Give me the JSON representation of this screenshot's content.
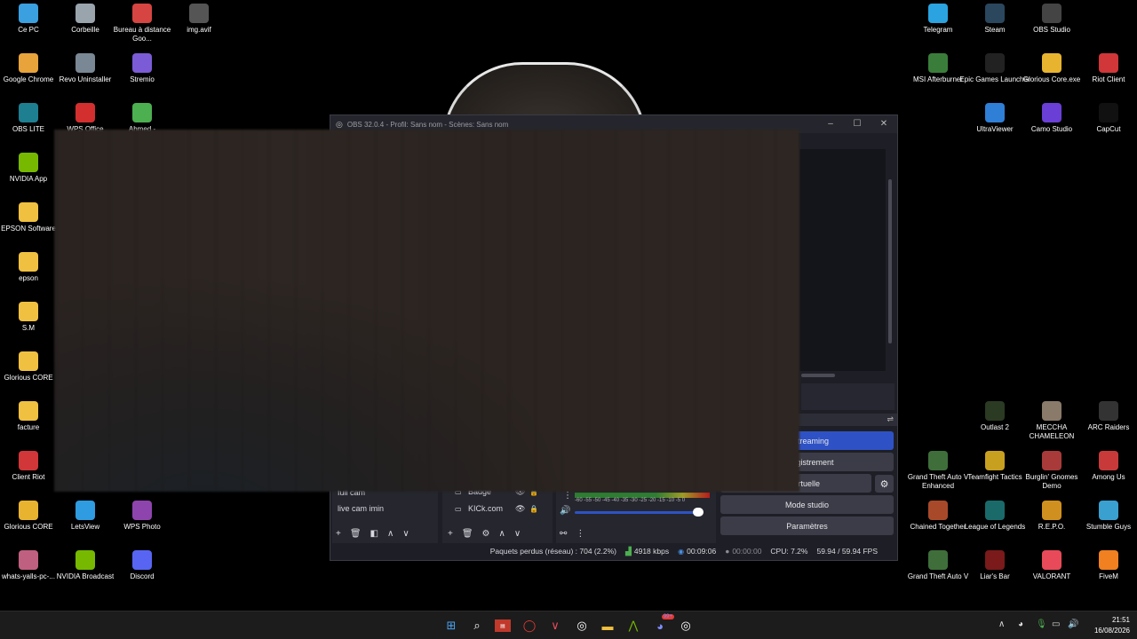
{
  "desktop_icons_left": [
    {
      "label": "Ce PC",
      "icon": "computer-icon",
      "color": "#3aa0e0"
    },
    {
      "label": "Corbeille",
      "icon": "recycle-bin-icon",
      "color": "#9aa4ad"
    },
    {
      "label": "Bureau à distance Goo...",
      "icon": "remote-desktop-icon",
      "color": "#d64541"
    },
    {
      "label": "img.avif",
      "icon": "image-file-icon",
      "color": "#555555"
    },
    {
      "label": "Google Chrome",
      "icon": "chrome-icon",
      "color": "#e8a33a"
    },
    {
      "label": "Revo Uninstaller",
      "icon": "revo-uninstaller-icon",
      "color": "#7a8794"
    },
    {
      "label": "Stremio",
      "icon": "stremio-icon",
      "color": "#7b5cd6"
    },
    {
      "label": "OBS LITE",
      "icon": "obs-lite-icon",
      "color": "#1e7f91"
    },
    {
      "label": "WPS Office",
      "icon": "wps-office-icon",
      "color": "#d32f2f"
    },
    {
      "label": "Ahmed -",
      "icon": "chrome-profile-icon",
      "color": "#4caf50"
    },
    {
      "label": "NVIDIA App",
      "icon": "nvidia-icon",
      "color": "#76b900"
    },
    {
      "label": "EPSON Software",
      "icon": "folder-icon",
      "color": "#f0c040"
    },
    {
      "label": "epson",
      "icon": "folder-icon",
      "color": "#f0c040"
    },
    {
      "label": "S.M",
      "icon": "folder-icon",
      "color": "#f0c040"
    },
    {
      "label": "Glorious CORE",
      "icon": "folder-icon",
      "color": "#f0c040"
    },
    {
      "label": "facture",
      "icon": "folder-icon",
      "color": "#f0c040"
    },
    {
      "label": "Client Riot",
      "icon": "riot-client-icon",
      "color": "#d13639"
    },
    {
      "label": "Glorious CORE",
      "icon": "glorious-core-icon",
      "color": "#e8b430"
    },
    {
      "label": "LetsView",
      "icon": "letsview-icon",
      "color": "#2f9be0"
    },
    {
      "label": "WPS Photo",
      "icon": "wps-photo-icon",
      "color": "#8e44ad"
    },
    {
      "label": "whats-yalls-pc-...",
      "icon": "image-file-icon",
      "color": "#c06080"
    },
    {
      "label": "NVIDIA Broadcast",
      "icon": "nvidia-broadcast-icon",
      "color": "#76b900"
    },
    {
      "label": "Discord",
      "icon": "discord-icon",
      "color": "#5865f2"
    }
  ],
  "desktop_icons_right": [
    {
      "label": "Telegram",
      "icon": "telegram-icon",
      "color": "#2aa3e0"
    },
    {
      "label": "Steam",
      "icon": "steam-icon",
      "color": "#2a475e"
    },
    {
      "label": "OBS Studio",
      "icon": "obs-studio-icon",
      "color": "#444444"
    },
    {
      "label": "MSI Afterburner",
      "icon": "msi-afterburner-icon",
      "color": "#3a7d3a"
    },
    {
      "label": "Epic Games Launcher",
      "icon": "epic-games-icon",
      "color": "#222222"
    },
    {
      "label": "Glorious Core.exe",
      "icon": "glorious-core-icon",
      "color": "#e8b430"
    },
    {
      "label": "Riot Client",
      "icon": "riot-client-icon",
      "color": "#d13639"
    },
    {
      "label": "UltraViewer",
      "icon": "ultraviewer-icon",
      "color": "#2f7fd6"
    },
    {
      "label": "Camo Studio",
      "icon": "camo-studio-icon",
      "color": "#6a3fd6"
    },
    {
      "label": "CapCut",
      "icon": "capcut-icon",
      "color": "#111111"
    },
    {
      "label": "Outlast 2",
      "icon": "outlast-2-icon",
      "color": "#2b3a22"
    },
    {
      "label": "MECCHA CHAMELEON",
      "icon": "meccha-chameleon-icon",
      "color": "#8a7a6a"
    },
    {
      "label": "ARC Raiders",
      "icon": "arc-raiders-icon",
      "color": "#333333"
    },
    {
      "label": "Grand Theft Auto V Enhanced",
      "icon": "gta-v-enhanced-icon",
      "color": "#3f6e3a"
    },
    {
      "label": "Teamfight Tactics",
      "icon": "teamfight-tactics-icon",
      "color": "#c8a020"
    },
    {
      "label": "Burglin' Gnomes Demo",
      "icon": "burglin-gnomes-icon",
      "color": "#a83a3a"
    },
    {
      "label": "Among Us",
      "icon": "among-us-icon",
      "color": "#c83a3a"
    },
    {
      "label": "Chained Together",
      "icon": "chained-together-icon",
      "color": "#a84a2a"
    },
    {
      "label": "League of Legends",
      "icon": "league-of-legends-icon",
      "color": "#1a6a6a"
    },
    {
      "label": "R.E.P.O.",
      "icon": "repo-icon",
      "color": "#d09020"
    },
    {
      "label": "Stumble Guys",
      "icon": "stumble-guys-icon",
      "color": "#3aa0d0"
    },
    {
      "label": "Grand Theft Auto V",
      "icon": "gta-v-icon",
      "color": "#3f6e3a"
    },
    {
      "label": "Liar's Bar",
      "icon": "liars-bar-icon",
      "color": "#7a1a1a"
    },
    {
      "label": "VALORANT",
      "icon": "valorant-icon",
      "color": "#e84a5a"
    },
    {
      "label": "FiveM",
      "icon": "fivem-icon",
      "color": "#f08020"
    }
  ],
  "obs": {
    "title": "OBS 32.0.4 - Profil: Sans nom - Scènes: Sans nom",
    "controls_header_icon": "⇌",
    "buttons": {
      "streaming": "le streaming",
      "recording": "enregistrement",
      "virtual_cam": "méra virtuelle",
      "studio_mode": "Mode studio",
      "settings": "Paramètres"
    },
    "scenes": [
      "full cam",
      "live cam imin"
    ],
    "sources": [
      {
        "name": "Badge"
      },
      {
        "name": "KICk.com"
      }
    ],
    "meter_ticks": "-60 -55 -50 -45 -40 -35 -30 -25 -20 -15 -10 -5 0",
    "status": {
      "dropped_frames": "Paquets perdus (réseau) : 704 (2.2%)",
      "bitrate": "4918 kbps",
      "stream_time": "00:09:06",
      "rec_time": "00:00:00",
      "cpu": "CPU: 7.2%",
      "fps": "59.94 / 59.94 FPS"
    },
    "accent": "#2e52c5"
  },
  "taskbar": {
    "time": "21:51",
    "date": "16/08/2026",
    "apps": [
      "windows-start-icon",
      "search-icon",
      "news-widget-icon",
      "opera-icon",
      "valorant-icon",
      "obs-studio-icon",
      "file-explorer-icon",
      "nvidia-broadcast-icon",
      "discord-icon",
      "obs-taskbar-icon"
    ],
    "discord_badge": "99+"
  }
}
